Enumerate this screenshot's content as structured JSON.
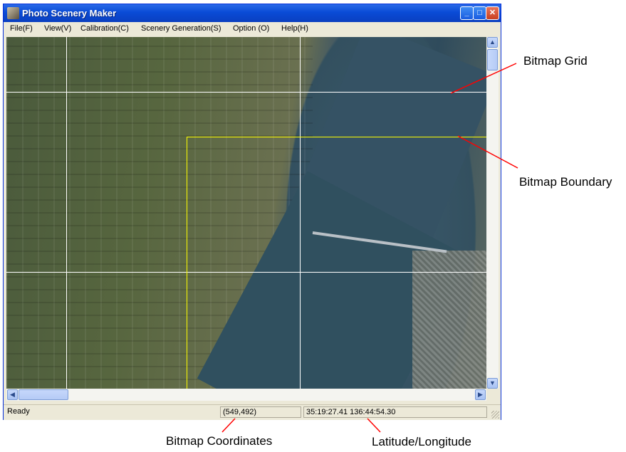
{
  "window": {
    "title": "Photo Scenery Maker"
  },
  "title_buttons": {
    "minimize": "_",
    "maximize": "□",
    "close": "✕"
  },
  "menu": {
    "items": [
      {
        "label": "File(F)"
      },
      {
        "label": "View(V)"
      },
      {
        "label": "Calibration(C)"
      },
      {
        "label": "Scenery Generation(S)"
      },
      {
        "label": "Option (O)"
      },
      {
        "label": "Help(H)"
      }
    ]
  },
  "status": {
    "ready": "Ready",
    "bitmap_coords": "(549,492)",
    "lat_lon": "35:19:27.41 136:44:54.30"
  },
  "annotations": {
    "bitmap_grid": "Bitmap Grid",
    "bitmap_boundary": "Bitmap Boundary",
    "bitmap_coordinates": "Bitmap Coordinates",
    "latitude_longitude": "Latitude/Longitude"
  },
  "colors": {
    "grid": "#ffffff",
    "boundary": "#ffff00",
    "annotation_line": "#ff0000",
    "titlebar": "#0a4bd6"
  },
  "icons": {
    "app": "app-icon",
    "scroll_up": "▲",
    "scroll_down": "▼",
    "scroll_left": "◀",
    "scroll_right": "▶"
  }
}
